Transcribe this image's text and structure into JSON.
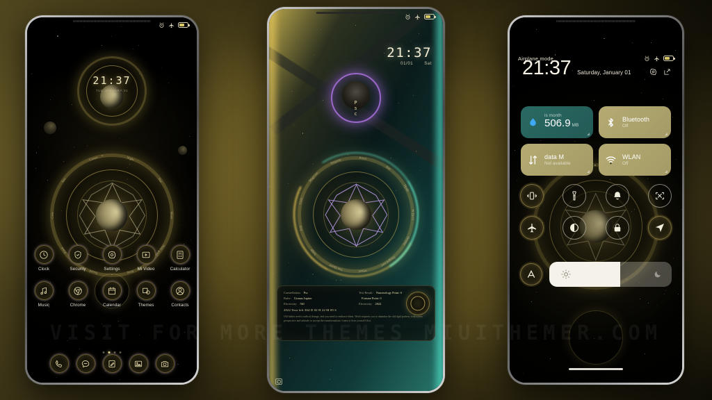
{
  "watermark": "VISIT FOR MORE THEMES MIUITHEMER.COM",
  "status_bar": {
    "alarm_icon": "alarm-clock-icon",
    "airplane_icon": "airplane-icon",
    "battery_icon": "battery-icon"
  },
  "left_phone": {
    "name": "home-screen",
    "clock_widget": {
      "time": "21:37",
      "subtext": "TUE  JANUARY  01"
    },
    "app_rows": [
      [
        {
          "label": "Clock",
          "icon": "clock-icon"
        },
        {
          "label": "Security",
          "icon": "shield-icon"
        },
        {
          "label": "Settings",
          "icon": "gear-icon"
        },
        {
          "label": "Mi Video",
          "icon": "video-play-icon"
        },
        {
          "label": "Calculator",
          "icon": "calculator-icon"
        }
      ],
      [
        {
          "label": "Music",
          "icon": "music-note-icon"
        },
        {
          "label": "Chrome",
          "icon": "chrome-icon"
        },
        {
          "label": "Calendar",
          "icon": "calendar-icon"
        },
        {
          "label": "Themes",
          "icon": "themes-icon"
        },
        {
          "label": "Contacts",
          "icon": "contacts-person-icon"
        }
      ]
    ],
    "page_dots": {
      "count": 4,
      "active_index": 1
    },
    "dock": [
      {
        "label": "Phone",
        "icon": "phone-handset-icon"
      },
      {
        "label": "Messages",
        "icon": "message-bubble-icon"
      },
      {
        "label": "Notes",
        "icon": "notes-pencil-icon"
      },
      {
        "label": "Gallery",
        "icon": "gallery-image-icon"
      },
      {
        "label": "Camera",
        "icon": "camera-icon"
      }
    ],
    "magic_circle_labels": [
      "Moon",
      "Holy grail",
      "King",
      "Sword",
      "Priest",
      "Cane",
      "Sun",
      "Crown",
      "Night",
      "Star"
    ]
  },
  "center_phone": {
    "name": "lock-screen",
    "clock": {
      "time": "21:37",
      "date": "01/01",
      "weekday": "Sat"
    },
    "orb": {
      "label_top": "P",
      "label_mid": "s",
      "label_bottom": "c"
    },
    "magic_circle_labels": [
      "W Devil",
      "Destiny",
      "Hanged man",
      "Wheel",
      "Sun Queen",
      "Judge",
      "Jury",
      "Coin",
      "Magician",
      "Empress",
      "Priest",
      "Star",
      "Death"
    ],
    "info_panel": {
      "rows": [
        {
          "key": "Constellation:",
          "value": "Psc"
        },
        {
          "key": "Test Result:",
          "value": "Numerology Point: 0"
        },
        {
          "key": "Ruler:",
          "value": "Uranus Jupiter"
        },
        {
          "key": "",
          "value": "Fortune Point: 0"
        },
        {
          "key": "Electricity:",
          "value": "561"
        },
        {
          "key": "Electricity:",
          "value": "2022"
        }
      ],
      "summary": "2022 Year  left  364 D 02 H 22 M 09 S",
      "body": "Old habits need a radical change, and you need to embrace them. Work requires you to abandon the old rigid pattern, with a new perspective and attitude to accept the transformation. Learn to love yourself first."
    },
    "camera_chip_icon": "camera-icon"
  },
  "right_phone": {
    "name": "control-center",
    "status_label": "Airplane mode",
    "time": "21:37",
    "date": "Saturday, January 01",
    "header_icons": [
      {
        "name": "settings-gear-icon"
      },
      {
        "name": "edit-pencil-icon"
      }
    ],
    "tiles": [
      {
        "id": "data-usage",
        "top": "is month",
        "value": "506.9",
        "unit": "MB",
        "icon": "water-drop-icon",
        "style": "teal"
      },
      {
        "id": "bluetooth",
        "title": "Bluetooth",
        "subtitle": "Off",
        "icon": "bluetooth-icon",
        "style": "khaki"
      },
      {
        "id": "mobile-data",
        "title": "data",
        "title_suffix": "M",
        "subtitle": "Not available",
        "icon": "data-arrows-icon",
        "style": "khaki"
      },
      {
        "id": "wlan",
        "title": "WLAN",
        "subtitle": "Off",
        "icon": "wifi-icon",
        "style": "khaki"
      }
    ],
    "toggles": [
      {
        "id": "vibrate",
        "icon": "vibrate-icon",
        "ornate": true
      },
      {
        "id": "flashlight",
        "icon": "flashlight-icon",
        "ornate": false
      },
      {
        "id": "do-not-disturb",
        "icon": "bell-icon",
        "ornate": false
      },
      {
        "id": "screenshot",
        "icon": "screenshot-icon",
        "ornate": false
      },
      {
        "id": "airplane-mode",
        "icon": "airplane-icon",
        "ornate": true
      },
      {
        "id": "dark-mode",
        "icon": "contrast-circle-icon",
        "ornate": false
      },
      {
        "id": "screen-lock",
        "icon": "lock-icon",
        "ornate": false
      },
      {
        "id": "location",
        "icon": "location-arrow-icon",
        "ornate": true
      },
      {
        "id": "auto-rotate",
        "icon": "auto-a-icon",
        "ornate": true
      }
    ],
    "brightness": {
      "value": 58,
      "left_icon": "sun-icon",
      "right_icon": "moon-icon"
    }
  },
  "colors": {
    "background_gold": "#6b5c26",
    "tile_teal": "#2a6a63",
    "tile_khaki": "#b5ab72",
    "accent_gold": "#e2d58f",
    "aura_purple": "#b276e8",
    "aura_teal": "#58f0d6"
  }
}
